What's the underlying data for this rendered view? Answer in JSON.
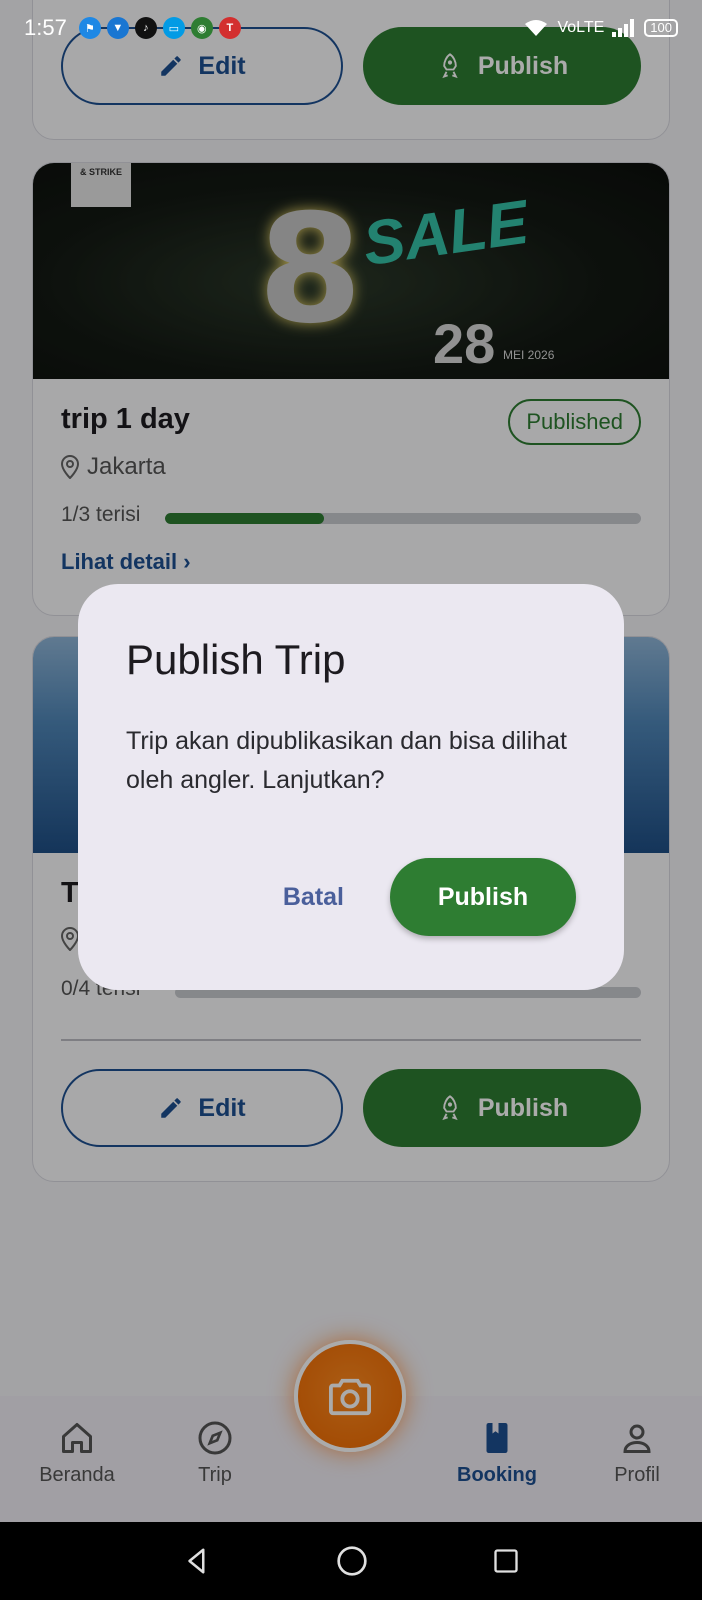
{
  "status_bar": {
    "time": "1:57",
    "network": "VoLTE",
    "battery": "100",
    "notification_icons": [
      "runner-icon",
      "shield-icon",
      "tiktok-icon",
      "message-icon",
      "location-icon",
      "telkomsel-icon"
    ]
  },
  "top_card": {
    "edit_label": "Edit",
    "publish_label": "Publish"
  },
  "trips": [
    {
      "title": "trip 1 day",
      "status": "Published",
      "location": "Jakarta",
      "capacity_text": "1/3 terisi",
      "filled": 1,
      "total": 3,
      "detail_link": "Lihat detail",
      "banner": {
        "corner_tag": "& STRIKE",
        "big_number": "8",
        "headline": "SALE",
        "date_number": "28",
        "date_text": "MEI 2026"
      }
    },
    {
      "title": "T",
      "capacity_text": "0/4 terisi",
      "filled": 0,
      "total": 4,
      "edit_label": "Edit",
      "publish_label": "Publish"
    }
  ],
  "dialog": {
    "title": "Publish Trip",
    "message": "Trip akan dipublikasikan dan bisa dilihat oleh angler. Lanjutkan?",
    "cancel_label": "Batal",
    "confirm_label": "Publish"
  },
  "bottom_nav": {
    "items": [
      {
        "label": "Beranda",
        "icon": "home-icon"
      },
      {
        "label": "Trip",
        "icon": "compass-icon"
      },
      {
        "label": "Booking",
        "icon": "book-icon",
        "active": true
      },
      {
        "label": "Profil",
        "icon": "person-icon"
      }
    ],
    "fab_icon": "camera-icon"
  },
  "colors": {
    "primary_green": "#2e7d32",
    "primary_blue": "#1d4f91",
    "fab_orange": "#f57c00",
    "dialog_bg": "#ebe8f1"
  }
}
